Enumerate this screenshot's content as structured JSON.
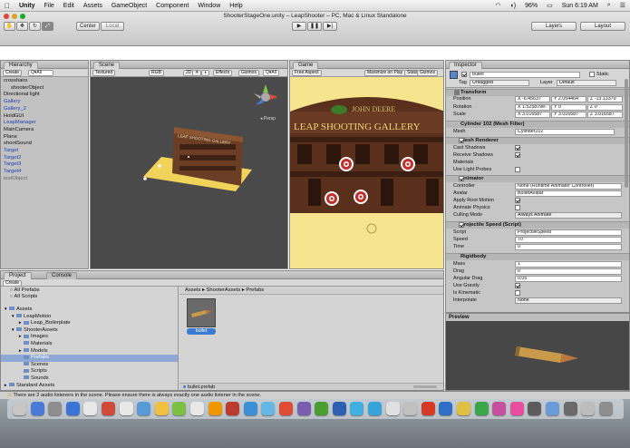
{
  "menubar": {
    "apple": "",
    "app": "Unity",
    "items": [
      "File",
      "Edit",
      "Assets",
      "GameObject",
      "Component",
      "Window",
      "Help"
    ],
    "battery": "96%",
    "clock": "Sun 6:19 AM"
  },
  "window": {
    "title": "ShooterStageOne.unity – LeapShooter – PC, Mac & Linux Standalone"
  },
  "toolbar": {
    "center": "Center",
    "local": "Local",
    "layers": "Layers",
    "layout": "Layout"
  },
  "hierarchy": {
    "tab": "Hierarchy",
    "create": "Create",
    "search": "Q▾All",
    "items": [
      {
        "label": "crosshairs",
        "indent": 0,
        "color": "black",
        "arrow": "▼"
      },
      {
        "label": "shooterObject",
        "indent": 1,
        "color": "black",
        "arrow": ""
      },
      {
        "label": "Directional light",
        "indent": 0,
        "color": "black",
        "arrow": ""
      },
      {
        "label": "Gallery",
        "indent": 0,
        "color": "blue",
        "arrow": "►"
      },
      {
        "label": "Gallery_2",
        "indent": 0,
        "color": "blue",
        "arrow": ""
      },
      {
        "label": "HoldGUI",
        "indent": 0,
        "color": "black",
        "arrow": ""
      },
      {
        "label": "LeapManager",
        "indent": 0,
        "color": "blue",
        "arrow": ""
      },
      {
        "label": "MainCamera",
        "indent": 0,
        "color": "black",
        "arrow": ""
      },
      {
        "label": "Plane",
        "indent": 0,
        "color": "black",
        "arrow": ""
      },
      {
        "label": "shootSound",
        "indent": 0,
        "color": "black",
        "arrow": ""
      },
      {
        "label": "Target",
        "indent": 0,
        "color": "blue",
        "arrow": ""
      },
      {
        "label": "Target2",
        "indent": 0,
        "color": "blue",
        "arrow": ""
      },
      {
        "label": "Target3",
        "indent": 0,
        "color": "blue",
        "arrow": ""
      },
      {
        "label": "Target4",
        "indent": 0,
        "color": "blue",
        "arrow": ""
      },
      {
        "label": "testObject",
        "indent": 0,
        "color": "grey",
        "arrow": ""
      }
    ]
  },
  "scene": {
    "tab": "Scene",
    "textured": "Textured",
    "rgb": "RGB",
    "mode2d": "2D",
    "effects": "Effects",
    "gizmos": "Gizmos",
    "search": "Q▾All",
    "persp": "◂ Persp",
    "sign": "LEAP SHOOTING GALLERY"
  },
  "game": {
    "tab": "Game",
    "aspect": "Free Aspect",
    "maximize": "Maximize on Play",
    "stats": "Stats",
    "gizmos": "Gizmos",
    "brand": "JOHN DEERE",
    "sign": "LEAP SHOOTING GALLERY"
  },
  "project": {
    "tab": "Project",
    "console_tab": "Console",
    "create": "Create",
    "favorites": [
      "All Prefabs",
      "All Scripts"
    ],
    "tree": [
      {
        "label": "Assets",
        "indent": 0,
        "arrow": "▼",
        "selected": false
      },
      {
        "label": "LeapMotion",
        "indent": 1,
        "arrow": "▼",
        "selected": false
      },
      {
        "label": "Leap_Boilerplate",
        "indent": 2,
        "arrow": "►",
        "selected": false
      },
      {
        "label": "ShooterAssets",
        "indent": 1,
        "arrow": "▼",
        "selected": false
      },
      {
        "label": "Images",
        "indent": 2,
        "arrow": "►",
        "selected": false
      },
      {
        "label": "Materials",
        "indent": 2,
        "arrow": "",
        "selected": false
      },
      {
        "label": "Models",
        "indent": 2,
        "arrow": "►",
        "selected": false
      },
      {
        "label": "Prefabs",
        "indent": 2,
        "arrow": "",
        "selected": true
      },
      {
        "label": "Scenes",
        "indent": 2,
        "arrow": "",
        "selected": false
      },
      {
        "label": "Scripts",
        "indent": 2,
        "arrow": "",
        "selected": false
      },
      {
        "label": "Sounds",
        "indent": 2,
        "arrow": "",
        "selected": false
      },
      {
        "label": "Standard Assets",
        "indent": 0,
        "arrow": "►",
        "selected": false
      }
    ],
    "breadcrumb": "Assets ▸ ShooterAssets ▸ Prefabs",
    "asset_name": "bullet",
    "footer_file": "bullet.prefab"
  },
  "inspector": {
    "tab": "Inspector",
    "object_name": "bullet",
    "static": "Static",
    "tag_label": "Tag",
    "tag_value": "Untagged",
    "layer_label": "Layer",
    "layer_value": "Default",
    "transform": {
      "header": "Transform",
      "rows": [
        {
          "label": "Position",
          "x": "X -6.45637",
          "y": "Y 2.054464",
          "z": "Z -13.13379"
        },
        {
          "label": "Rotation",
          "x": "X 1.525879e-",
          "y": "Y 0",
          "z": "Z 0"
        },
        {
          "label": "Scale",
          "x": "X 3.016587",
          "y": "Y 3.016587",
          "z": "Z 3.016587"
        }
      ]
    },
    "meshfilter": {
      "header": "Cylinder 102 (Mesh Filter)",
      "mesh_label": "Mesh",
      "mesh_value": "Cylinder102"
    },
    "renderer": {
      "header": "Mesh Renderer",
      "cast": "Cast Shadows",
      "receive": "Receive Shadows",
      "materials": "Materials",
      "probes": "Use Light Probes"
    },
    "animator": {
      "header": "Animator",
      "controller_label": "Controller",
      "controller_value": "None (Runtime Animator Controller)",
      "avatar_label": "Avatar",
      "avatar_value": "BulletAvatar",
      "root": "Apply Root Motion",
      "physics": "Animate Physics",
      "culling_label": "Culling Mode",
      "culling_value": "Always Animate"
    },
    "projectile": {
      "header": "Projectile Speed (Script)",
      "script_label": "Script",
      "script_value": "ProjectileSpeed",
      "speed_label": "Speed",
      "speed_value": "70",
      "time_label": "Time",
      "time_value": "0"
    },
    "rigidbody": {
      "header": "Rigidbody",
      "mass_label": "Mass",
      "mass_value": "1",
      "drag_label": "Drag",
      "drag_value": "0",
      "angdrag_label": "Angular Drag",
      "angdrag_value": "0.05",
      "gravity": "Use Gravity",
      "kinematic": "Is Kinematic",
      "interp_label": "Interpolate",
      "interp_value": "None"
    },
    "preview": "Preview"
  },
  "status": {
    "message": "There are 2 audio listeners in the scene. Please ensure there is always exactly one audio listener in the scene."
  },
  "dock": {
    "colors": [
      "#c6c6c6",
      "#4a7ad8",
      "#8e8e8e",
      "#3b74d8",
      "#e8e8e8",
      "#d04a3a",
      "#e8e8e8",
      "#5a9ad8",
      "#f0c040",
      "#7bc043",
      "#e8e8e8",
      "#f29600",
      "#bd3a2f",
      "#3d8fd6",
      "#67b7e6",
      "#df4b33",
      "#7a5cb0",
      "#4c9d2f",
      "#2f5fb3",
      "#40b0e0",
      "#36a3d9",
      "#e0e0e0",
      "#c0c0c0",
      "#d53a24",
      "#2f6fc6",
      "#e0c040",
      "#3aa64a",
      "#c74fa0",
      "#e84ea0",
      "#5c5c5c",
      "#6b9ad8",
      "#6a6a6a",
      "#bcbcbc",
      "#8e8e8e"
    ]
  }
}
